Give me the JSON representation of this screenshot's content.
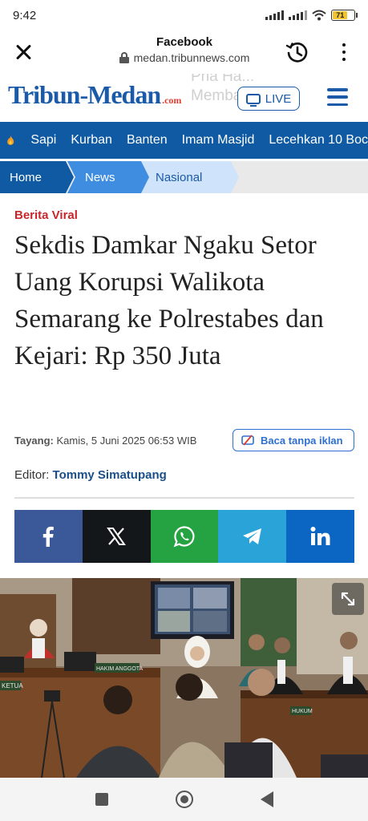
{
  "status_bar": {
    "time": "9:42",
    "battery_level": "71"
  },
  "browser": {
    "title": "Facebook",
    "url": "medan.tribunnews.com"
  },
  "site": {
    "logo_main": "Tribun-Medan",
    "logo_suffix": ".com",
    "live_label": "LIVE",
    "brand_color": "#1a5aa8",
    "ad_text": "Pria Ha... Memba..."
  },
  "topics": [
    "Sapi",
    "Kurban",
    "Banten",
    "Imam Masjid",
    "Lecehkan 10 Boc"
  ],
  "breadcrumb": [
    "Home",
    "News",
    "Nasional"
  ],
  "article": {
    "category": "Berita Viral",
    "headline": "Sekdis Damkar Ngaku Setor Uang Korupsi Walikota Semarang ke Polrestabes dan Kejari: Rp 350 Juta",
    "published_label": "Tayang:",
    "published_value": "Kamis, 5 Juni 2025 06:53 WIB",
    "ads_free_label": "Baca tanpa iklan",
    "editor_label": "Editor:",
    "editor_name": "Tommy Simatupang"
  },
  "share": [
    {
      "network": "facebook",
      "icon": "facebook-icon",
      "color": "#3b5998"
    },
    {
      "network": "x",
      "icon": "x-icon",
      "color": "#14171a"
    },
    {
      "network": "whatsapp",
      "icon": "whatsapp-icon",
      "color": "#25a342"
    },
    {
      "network": "telegram",
      "icon": "telegram-icon",
      "color": "#2aa3d8"
    },
    {
      "network": "linkedin",
      "icon": "linkedin-icon",
      "color": "#0a66c2"
    }
  ],
  "photo": {
    "nameplate_left": "KETUA",
    "nameplate_center": "HAKIM ANGGOTA",
    "nameplate_right": "HUKUM"
  }
}
